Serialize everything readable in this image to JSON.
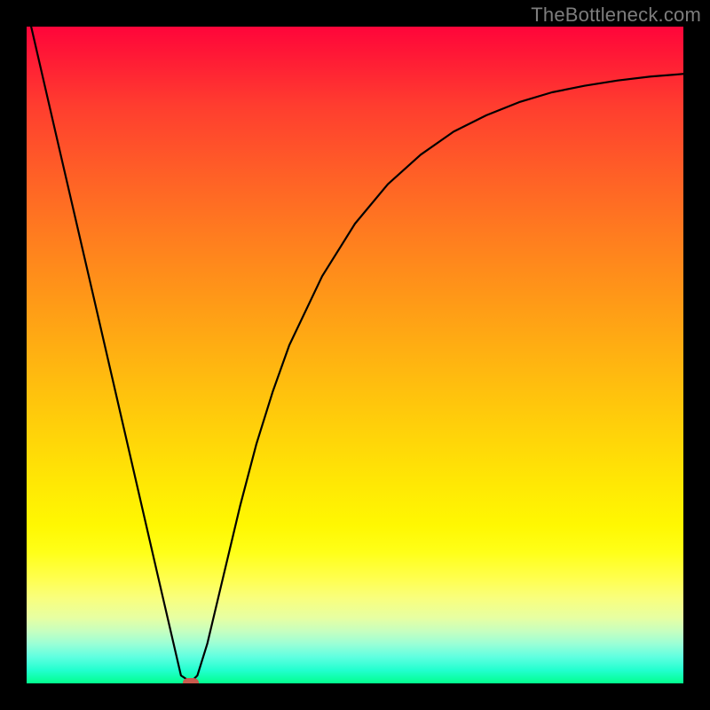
{
  "watermark": "TheBottleneck.com",
  "chart_data": {
    "type": "line",
    "title": "",
    "xlabel": "",
    "ylabel": "",
    "xlim": [
      0,
      1
    ],
    "ylim": [
      0,
      1
    ],
    "series": [
      {
        "name": "curve",
        "x": [
          0.0,
          0.05,
          0.1,
          0.15,
          0.2,
          0.235,
          0.25,
          0.26,
          0.275,
          0.3,
          0.325,
          0.35,
          0.375,
          0.4,
          0.45,
          0.5,
          0.55,
          0.6,
          0.65,
          0.7,
          0.75,
          0.8,
          0.85,
          0.9,
          0.95,
          1.0
        ],
        "y": [
          1.03,
          0.813,
          0.597,
          0.38,
          0.163,
          0.012,
          0.002,
          0.012,
          0.06,
          0.165,
          0.27,
          0.365,
          0.445,
          0.515,
          0.62,
          0.7,
          0.76,
          0.805,
          0.84,
          0.865,
          0.885,
          0.9,
          0.91,
          0.918,
          0.924,
          0.928
        ]
      }
    ],
    "marker": {
      "x": 0.25,
      "y": 0.0
    },
    "gradient_stops": [
      {
        "pos": 0.0,
        "color": "#ff053a"
      },
      {
        "pos": 0.5,
        "color": "#ffb710"
      },
      {
        "pos": 0.8,
        "color": "#ffff18"
      },
      {
        "pos": 1.0,
        "color": "#02ff8e"
      }
    ],
    "colors": {
      "curve": "#000000",
      "marker": "#c85a4d",
      "frame": "#000000"
    }
  }
}
